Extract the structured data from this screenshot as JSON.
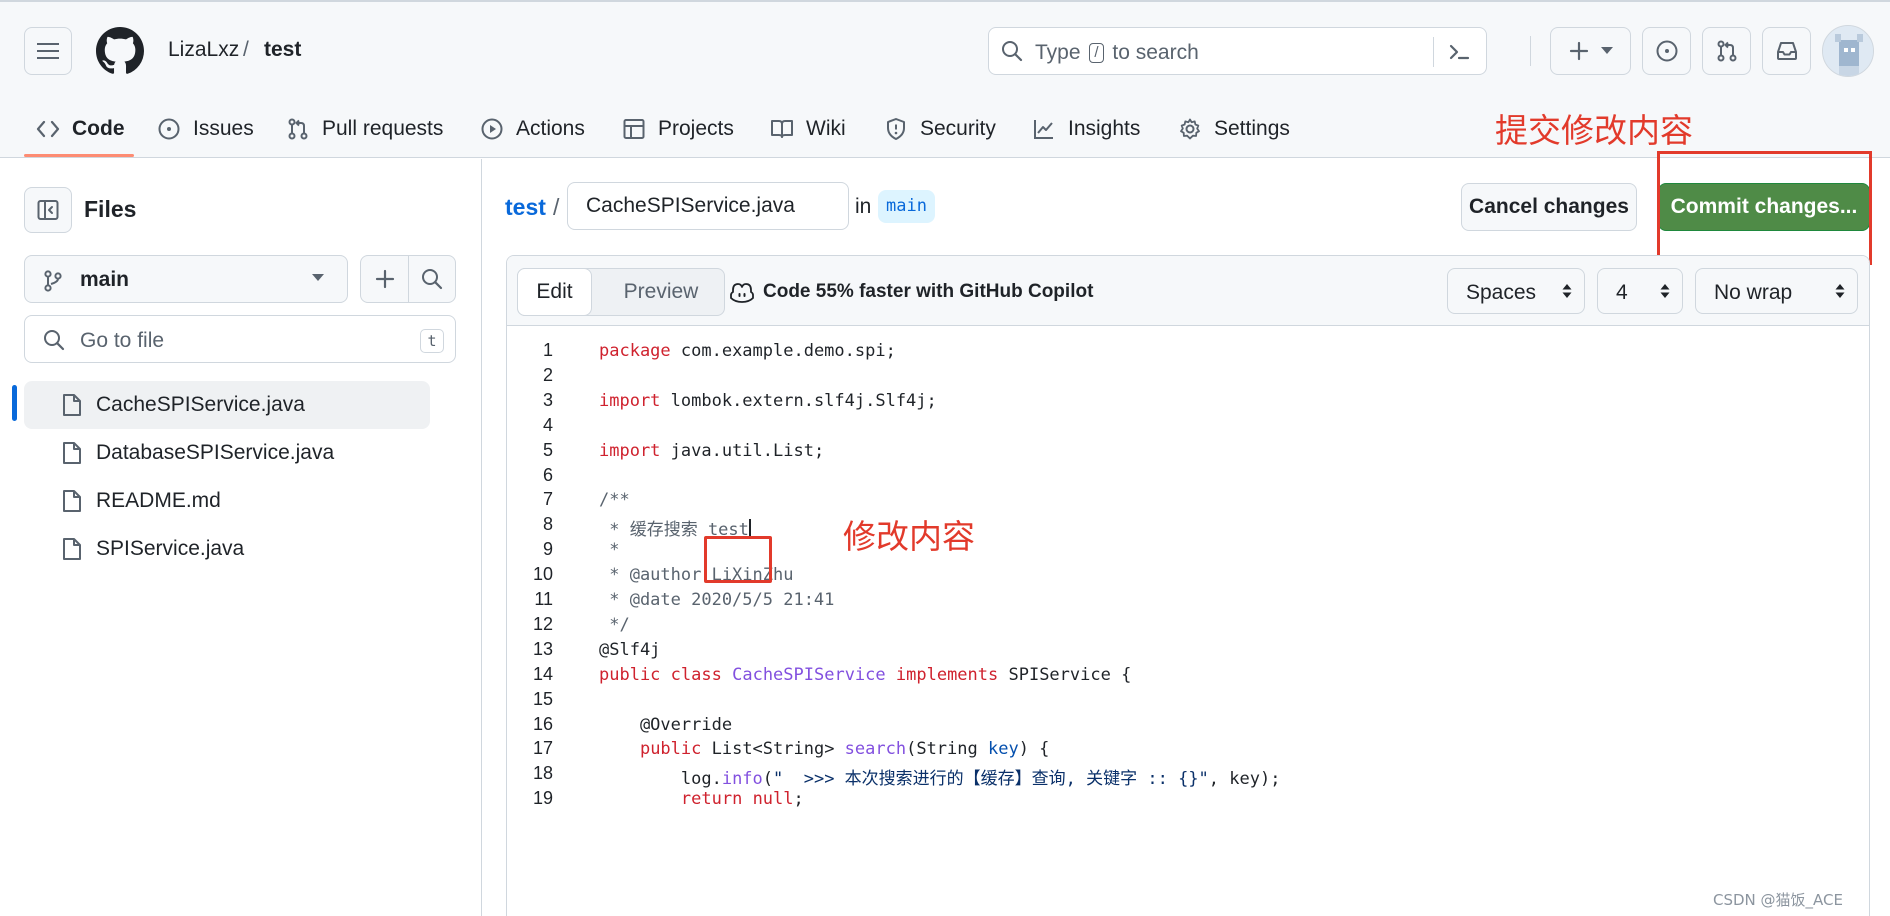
{
  "header": {
    "owner": "LizaLxz",
    "separator": "/",
    "repo": "test",
    "search": {
      "prefix": "Type",
      "key": "/",
      "suffix": "to search"
    }
  },
  "repo_nav": {
    "tabs": [
      {
        "label": "Code",
        "icon": "code-icon",
        "active": true
      },
      {
        "label": "Issues",
        "icon": "issue-opened-icon"
      },
      {
        "label": "Pull requests",
        "icon": "git-pull-request-icon"
      },
      {
        "label": "Actions",
        "icon": "play-icon"
      },
      {
        "label": "Projects",
        "icon": "table-icon"
      },
      {
        "label": "Wiki",
        "icon": "book-icon"
      },
      {
        "label": "Security",
        "icon": "shield-icon"
      },
      {
        "label": "Insights",
        "icon": "graph-icon"
      },
      {
        "label": "Settings",
        "icon": "gear-icon"
      }
    ]
  },
  "annotations": {
    "commit_note": "提交修改内容",
    "edit_note": "修改内容",
    "accent": "#e23a2b"
  },
  "sidebar": {
    "title": "Files",
    "branch": "main",
    "goto_placeholder": "Go to file",
    "goto_key": "t",
    "files": [
      {
        "name": "CacheSPIService.java",
        "selected": true
      },
      {
        "name": "DatabaseSPIService.java"
      },
      {
        "name": "README.md"
      },
      {
        "name": "SPIService.java"
      }
    ]
  },
  "editor": {
    "repo_link": "test",
    "path_sep": "/",
    "filename": "CacheSPIService.java",
    "in_word": "in",
    "branch": "main",
    "cancel_label": "Cancel changes",
    "commit_label": "Commit changes...",
    "tabs": {
      "edit": "Edit",
      "preview": "Preview"
    },
    "copilot_tip": "Code 55% faster with GitHub Copilot",
    "indent_mode": "Spaces",
    "indent_size": "4",
    "wrap_mode": "No wrap",
    "commit_color": "#4f8b47",
    "lines": [
      "package com.example.demo.spi;",
      "",
      "import lombok.extern.slf4j.Slf4j;",
      "",
      "import java.util.List;",
      "",
      "/**",
      " * 缓存搜索 test",
      " *",
      " * @author LiXinZhu",
      " * @date 2020/5/5 21:41",
      " */",
      "@Slf4j",
      "public class CacheSPIService implements SPIService {",
      "",
      "    @Override",
      "    public List<String> search(String key) {",
      "        log.info(\"  >>> 本次搜索进行的【缓存】查询, 关键字 :: {}\", key);",
      "        return null;"
    ]
  },
  "watermark": "CSDN @猫饭_ACE"
}
